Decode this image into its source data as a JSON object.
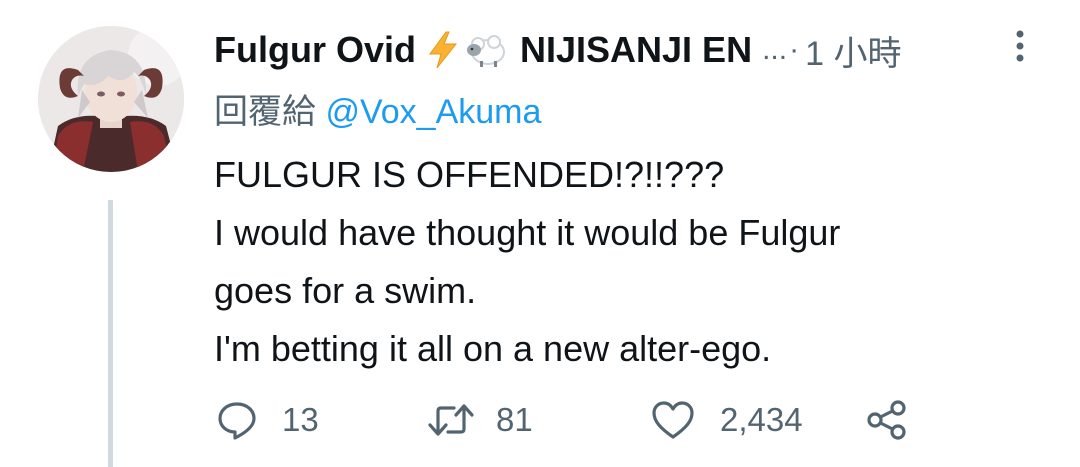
{
  "tweet": {
    "display_name": "Fulgur Ovid",
    "name_emojis": [
      "lightning-emoji",
      "sheep-emoji"
    ],
    "affiliation": "NIJISANJI EN",
    "ellipsis": "...",
    "separator": "·",
    "timestamp": "1 小時",
    "reply_prefix": "回覆給",
    "reply_handle": "@Vox_Akuma",
    "body_lines": [
      "FULGUR IS OFFENDED!?!!???",
      "I would have thought it would be Fulgur",
      "goes for a swim.",
      "I'm betting it all on a new alter-ego."
    ]
  },
  "actions": {
    "reply_count": "13",
    "retweet_count": "81",
    "like_count": "2,434"
  },
  "icons": {
    "reply": "reply-icon",
    "retweet": "retweet-icon",
    "like": "heart-icon",
    "share": "share-icon",
    "more": "more-vertical-icon"
  },
  "colors": {
    "text": "#0f1419",
    "muted": "#536471",
    "link": "#1d9bf0",
    "thread_line": "#cfd9de",
    "lightning": "#f9b233"
  }
}
